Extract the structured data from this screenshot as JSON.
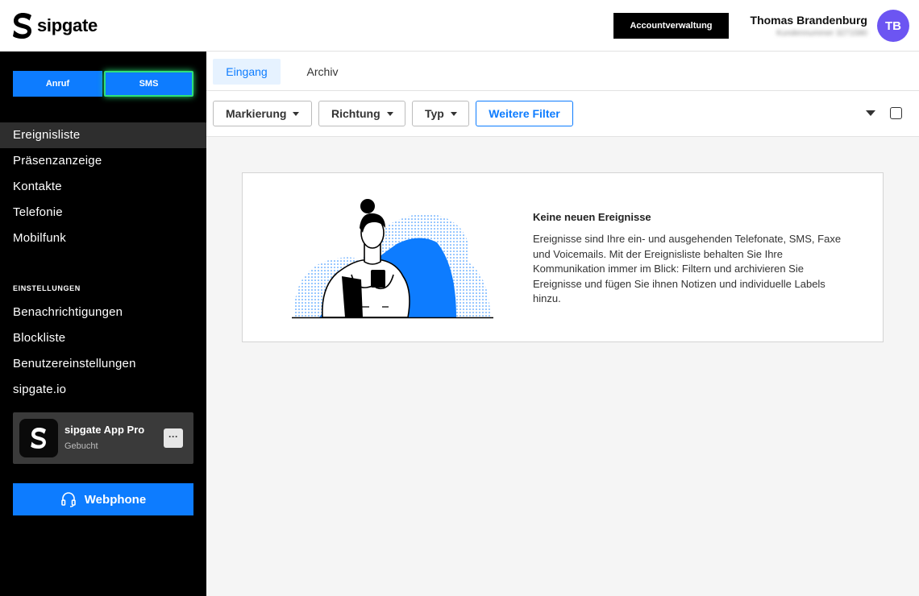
{
  "header": {
    "logo_text": "sipgate",
    "account_button": "Accountverwaltung",
    "user_name": "Thomas Brandenburg",
    "user_customer_number": "Kundennummer 3271580",
    "avatar_initials": "TB"
  },
  "sidebar": {
    "call_button": "Anruf",
    "sms_button": "SMS",
    "nav_items": [
      {
        "label": "Ereignisliste",
        "active": true
      },
      {
        "label": "Präsenzanzeige",
        "active": false
      },
      {
        "label": "Kontakte",
        "active": false
      },
      {
        "label": "Telefonie",
        "active": false
      },
      {
        "label": "Mobilfunk",
        "active": false
      }
    ],
    "settings_heading": "EINSTELLUNGEN",
    "settings_items": [
      {
        "label": "Benachrichtigungen"
      },
      {
        "label": "Blockliste"
      },
      {
        "label": "Benutzereinstellungen"
      },
      {
        "label": "sipgate.io"
      }
    ],
    "app_card": {
      "title": "sipgate App Pro",
      "status": "Gebucht",
      "more_label": "···"
    },
    "webphone_button": "Webphone"
  },
  "main": {
    "tabs": [
      {
        "label": "Eingang",
        "active": true
      },
      {
        "label": "Archiv",
        "active": false
      }
    ],
    "filters": {
      "marking": "Markierung",
      "direction": "Richtung",
      "type": "Typ",
      "more": "Weitere Filter"
    },
    "empty_state": {
      "title": "Keine neuen Ereignisse",
      "text": "Ereignisse sind Ihre ein- und ausgehenden Telefonate, SMS, Faxe und Voicemails. Mit der Ereignisliste behalten Sie Ihre Kommunikation immer im Blick: Filtern und archivieren Sie Ereignisse und fügen Sie ihnen Notizen und individuelle Labels hinzu."
    }
  },
  "colors": {
    "brand_blue": "#0d7cff",
    "sidebar_bg": "#000000",
    "active_nav_bg": "#2e2e2e",
    "avatar_bg": "#6c55f2",
    "sms_highlight": "#2ee07a"
  },
  "icons": {
    "logo": "sipgate-logo-icon",
    "headset": "headset-icon",
    "dropdown": "caret-down-icon",
    "checkbox": "checkbox-icon"
  }
}
